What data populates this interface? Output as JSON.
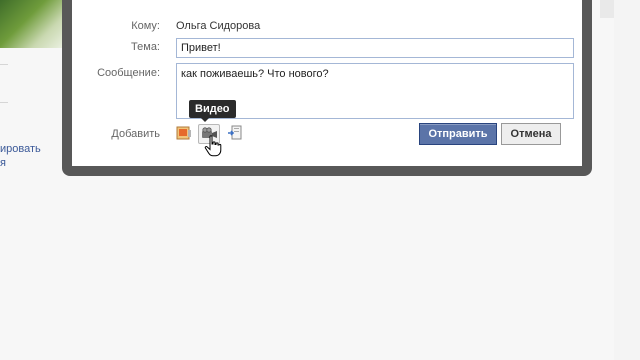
{
  "background": {
    "partial_link_line1": "ировать",
    "partial_link_line2": "я"
  },
  "dialog": {
    "recipient_label": "Кому:",
    "recipient_value": "Ольга Сидорова",
    "subject_label": "Тема:",
    "subject_value": "Привет!",
    "message_label": "Сообщение:",
    "message_value": "как поживаешь? Что нового?",
    "attach_label": "Добавить",
    "attachments": [
      {
        "name": "photo",
        "icon": "photo-attach-icon"
      },
      {
        "name": "video",
        "icon": "video-camera-icon"
      },
      {
        "name": "link",
        "icon": "link-attach-icon"
      }
    ],
    "tooltip": "Видео",
    "send_label": "Отправить",
    "cancel_label": "Отмена"
  },
  "colors": {
    "frame": "#585858",
    "primary_button": "#5b74a8",
    "input_border": "#a4b7d6",
    "link": "#3b5998"
  }
}
